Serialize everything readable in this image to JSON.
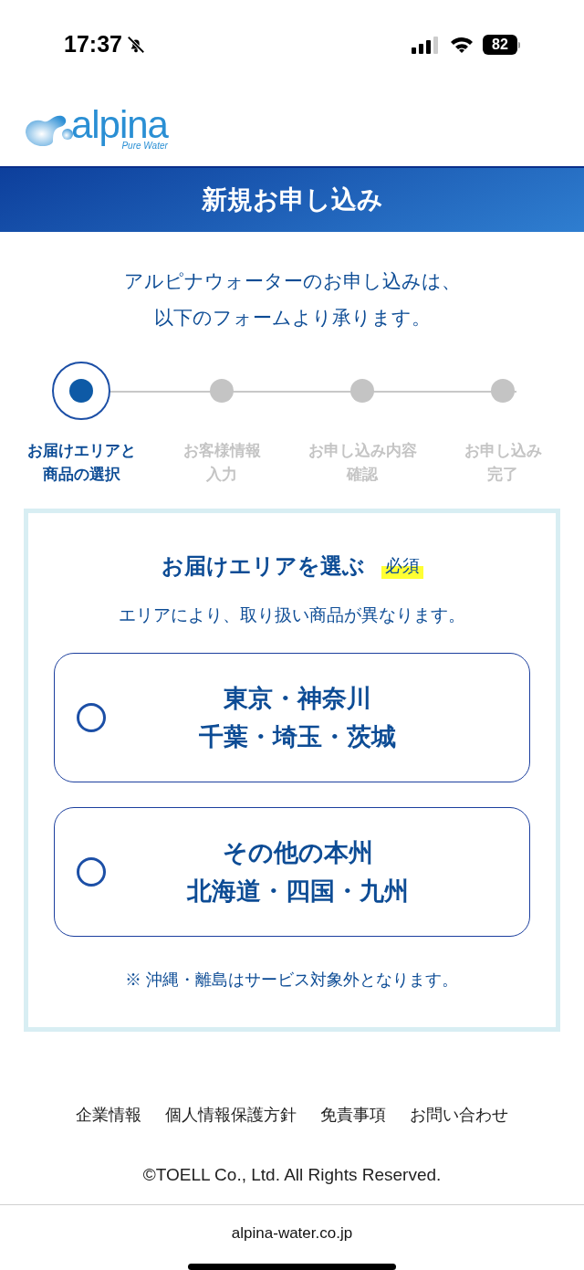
{
  "status_bar": {
    "time": "17:37",
    "silent": true,
    "battery": "82"
  },
  "logo": {
    "name": "alpina",
    "tagline": "Pure Water"
  },
  "header": {
    "title": "新規お申し込み"
  },
  "intro": [
    "アルピナウォーターのお申し込みは、",
    "以下のフォームより承ります。"
  ],
  "steps": [
    {
      "lines": [
        "お届けエリアと",
        "商品の選択"
      ],
      "selected": true
    },
    {
      "lines": [
        "お客様情報",
        "入力"
      ],
      "selected": false
    },
    {
      "lines": [
        "お申し込み内容",
        "確認"
      ],
      "selected": false
    },
    {
      "lines": [
        "お申し込み",
        "完了"
      ],
      "selected": false
    }
  ],
  "area_card": {
    "title": "お届けエリアを選ぶ",
    "badge": "必須",
    "description": "エリアにより、取り扱い商品が異なります。",
    "options": [
      {
        "lines": [
          "東京・神奈川",
          "千葉・埼玉・茨城"
        ],
        "selected": false
      },
      {
        "lines": [
          "その他の本州",
          "北海道・四国・九州"
        ],
        "selected": false
      }
    ],
    "note": "※ 沖縄・離島はサービス対象外となります。"
  },
  "footer": {
    "links": [
      "企業情報",
      "個人情報保護方針",
      "免責事項",
      "お問い合わせ"
    ],
    "copyright": "©TOELL Co., Ltd. All Rights Reserved."
  },
  "browser": {
    "url": "alpina-water.co.jp"
  }
}
